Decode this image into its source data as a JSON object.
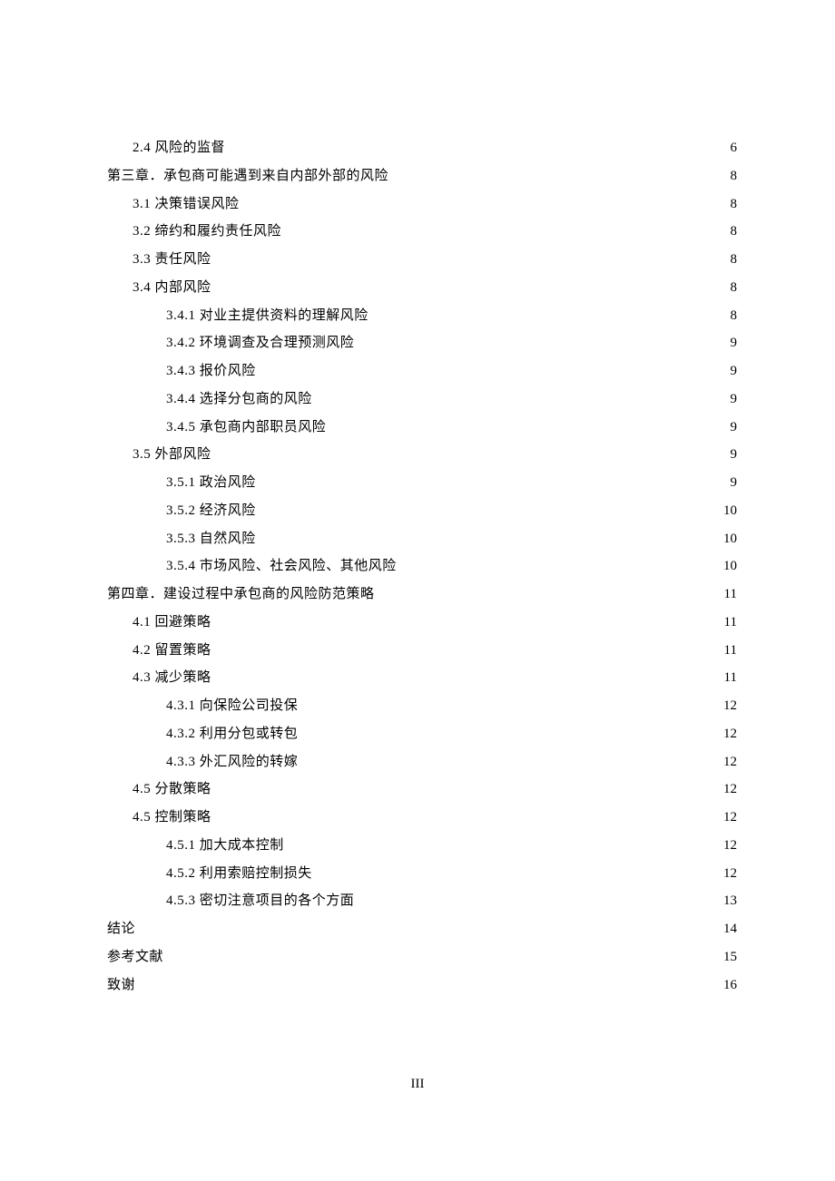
{
  "page_number_label": "III",
  "toc": [
    {
      "level": 1,
      "title": "2.4 风险的监督",
      "page": "6"
    },
    {
      "level": 0,
      "title": "第三章．承包商可能遇到来自内部外部的风险",
      "page": "8"
    },
    {
      "level": 1,
      "title": "3.1 决策错误风险",
      "page": "8"
    },
    {
      "level": 1,
      "title": "3.2 缔约和履约责任风险",
      "page": "8"
    },
    {
      "level": 1,
      "title": "3.3 责任风险",
      "page": "8"
    },
    {
      "level": 1,
      "title": "3.4 内部风险",
      "page": "8"
    },
    {
      "level": 2,
      "title": "3.4.1 对业主提供资料的理解风险",
      "page": "8"
    },
    {
      "level": 2,
      "title": "3.4.2 环境调查及合理预测风险",
      "page": "9"
    },
    {
      "level": 2,
      "title": "3.4.3 报价风险",
      "page": "9"
    },
    {
      "level": 2,
      "title": "3.4.4 选择分包商的风险",
      "page": "9"
    },
    {
      "level": 2,
      "title": "3.4.5 承包商内部职员风险",
      "page": "9"
    },
    {
      "level": 1,
      "title": "3.5 外部风险",
      "page": "9"
    },
    {
      "level": 2,
      "title": "3.5.1 政治风险",
      "page": "9"
    },
    {
      "level": 2,
      "title": "3.5.2 经济风险",
      "page": "10"
    },
    {
      "level": 2,
      "title": "3.5.3 自然风险",
      "page": "10"
    },
    {
      "level": 2,
      "title": "3.5.4 市场风险、社会风险、其他风险",
      "page": "10"
    },
    {
      "level": 0,
      "title": "第四章．建设过程中承包商的风险防范策略",
      "page": "11"
    },
    {
      "level": 1,
      "title": "4.1 回避策略",
      "page": "11"
    },
    {
      "level": 1,
      "title": "4.2 留置策略",
      "page": "11"
    },
    {
      "level": 1,
      "title": "4.3 减少策略",
      "page": "11"
    },
    {
      "level": 2,
      "title": "4.3.1 向保险公司投保",
      "page": "12"
    },
    {
      "level": 2,
      "title": "4.3.2 利用分包或转包",
      "page": "12"
    },
    {
      "level": 2,
      "title": "4.3.3 外汇风险的转嫁",
      "page": "12"
    },
    {
      "level": 1,
      "title": "4.5 分散策略",
      "page": "12"
    },
    {
      "level": 1,
      "title": "4.5 控制策略",
      "page": "12"
    },
    {
      "level": 2,
      "title": "4.5.1 加大成本控制",
      "page": "12"
    },
    {
      "level": 2,
      "title": "4.5.2 利用索赔控制损失",
      "page": "12"
    },
    {
      "level": 2,
      "title": "4.5.3 密切注意项目的各个方面",
      "page": "13"
    },
    {
      "level": 0,
      "title": "结论",
      "page": "14"
    },
    {
      "level": 0,
      "title": "参考文献",
      "page": "15"
    },
    {
      "level": 0,
      "title": "致谢",
      "page": "16"
    }
  ]
}
